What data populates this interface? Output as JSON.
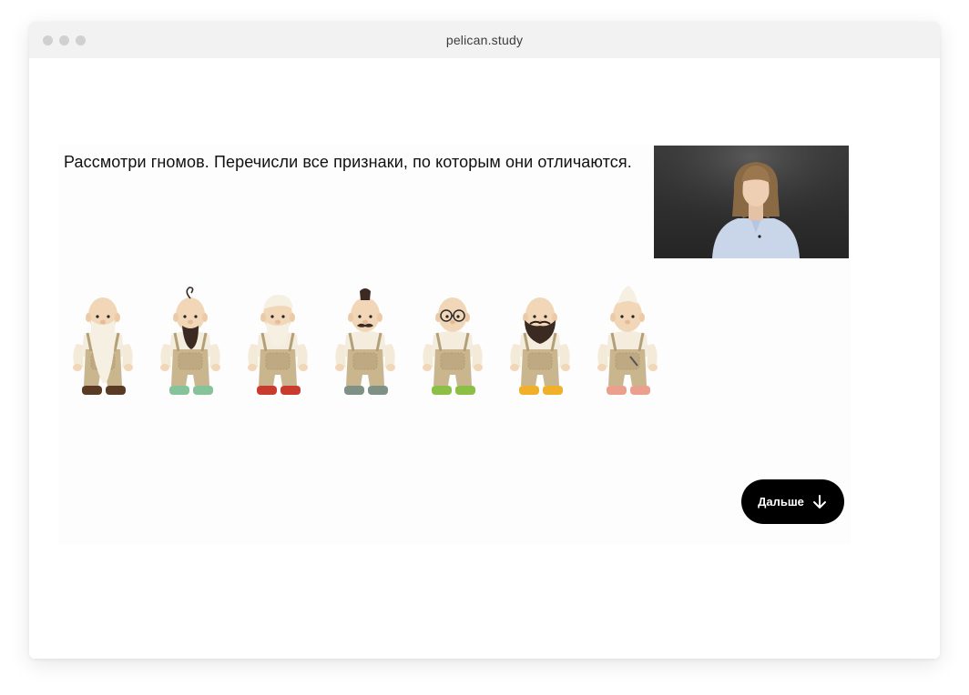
{
  "browser": {
    "url": "pelican.study"
  },
  "lesson": {
    "question": "Рассмотри гномов. Перечисли все признаки, по которым они отличаются.",
    "next_label": "Дальше"
  },
  "gnomes": [
    {
      "id": 1,
      "feature": "long-white-beard",
      "shoe_color": "#5b3a24"
    },
    {
      "id": 2,
      "feature": "dark-beard-curl",
      "shoe_color": "#86c39a"
    },
    {
      "id": 3,
      "feature": "white-hair-beard",
      "shoe_color": "#c93b2f"
    },
    {
      "id": 4,
      "feature": "mustache-topknot",
      "shoe_color": "#7f9184"
    },
    {
      "id": 5,
      "feature": "round-glasses",
      "shoe_color": "#8cbf45"
    },
    {
      "id": 6,
      "feature": "dark-beard-mustache",
      "shoe_color": "#f0b02a"
    },
    {
      "id": 7,
      "feature": "white-hair-knife",
      "shoe_color": "#eba08e"
    }
  ],
  "colors": {
    "button_bg": "#000000",
    "button_text": "#ffffff",
    "overalls": "#c9b68f",
    "skin": "#f1d7b8"
  }
}
